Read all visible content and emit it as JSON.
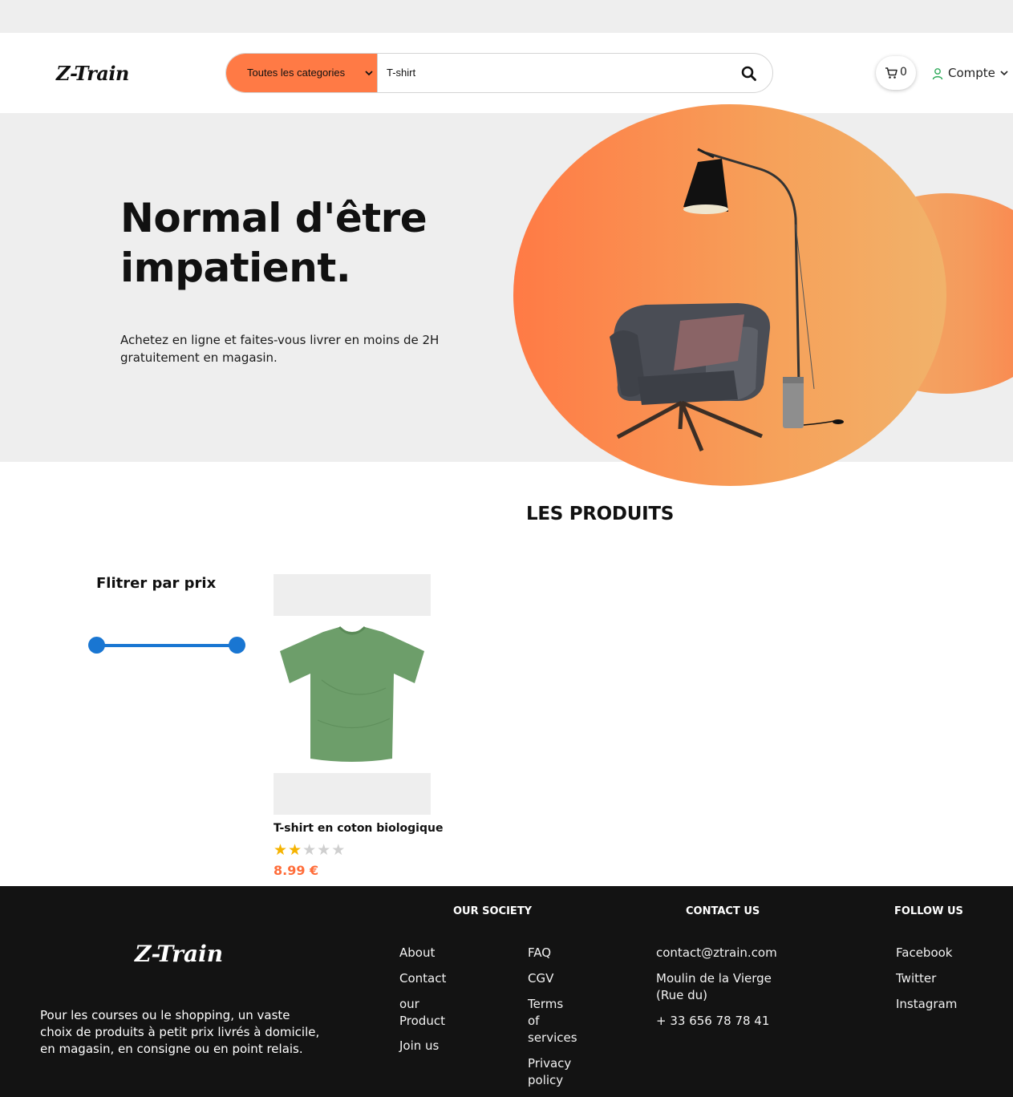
{
  "header": {
    "logo": "Z-Train",
    "category_select": "Toutes les categories",
    "search_value": "T-shirt",
    "cart_count": "0",
    "account_label": "Compte"
  },
  "hero": {
    "title": "Normal d'être impatient.",
    "subtitle": "Achetez en ligne et faites-vous livrer en moins de 2H gratuitement en magasin."
  },
  "products_section": {
    "title": "LES PRODUITS",
    "filter_title": "Flitrer par prix",
    "price_range": {
      "min_fraction": 0.0,
      "max_fraction": 1.0
    },
    "products": [
      {
        "name": "T-shirt en coton biologique",
        "rating": 2,
        "rating_max": 5,
        "price": "8.99 €",
        "icon": "green-tshirt-image"
      }
    ]
  },
  "footer": {
    "logo": "Z-Train",
    "description": "Pour les courses ou le shopping, un vaste choix de produits à petit prix livrés à domicile, en magasin, en consigne ou en point relais.",
    "society": {
      "heading": "OUR SOCIETY",
      "col1": [
        "About",
        "Contact",
        "our Product",
        "Join us"
      ],
      "col2": [
        "FAQ",
        "CGV",
        "Terms of services",
        "Privacy policy"
      ]
    },
    "contact": {
      "heading": "CONTACT US",
      "email": "contact@ztrain.com",
      "address": "Moulin de la Vierge (Rue du)",
      "phone": "+ 33 656 78 78 41"
    },
    "follow": {
      "heading": "FOLLOW US",
      "links": [
        "Facebook",
        "Twitter",
        "Instagram"
      ]
    }
  },
  "colors": {
    "accent": "#ff7a45",
    "price": "#ff6d3a",
    "slider": "#1976d2",
    "star": "#f5b301",
    "footer_bg": "#131313",
    "hero_bg": "#eeeeee"
  }
}
